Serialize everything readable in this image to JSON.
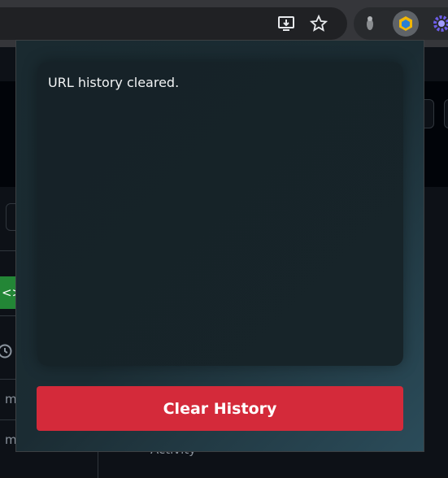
{
  "popup": {
    "message": "URL history cleared.",
    "clear_button_label": "Clear History"
  },
  "background_page": {
    "visible_fragments": [
      "m",
      "m",
      "Activity"
    ]
  },
  "colors": {
    "accent_red": "#d42a3a",
    "popup_bg": "#1b2c33",
    "text": "#f1f3f4"
  },
  "icons": [
    "install-app-icon",
    "bookmark-star-icon",
    "extension-icon",
    "active-extension-icon",
    "gear-extension-icon"
  ]
}
